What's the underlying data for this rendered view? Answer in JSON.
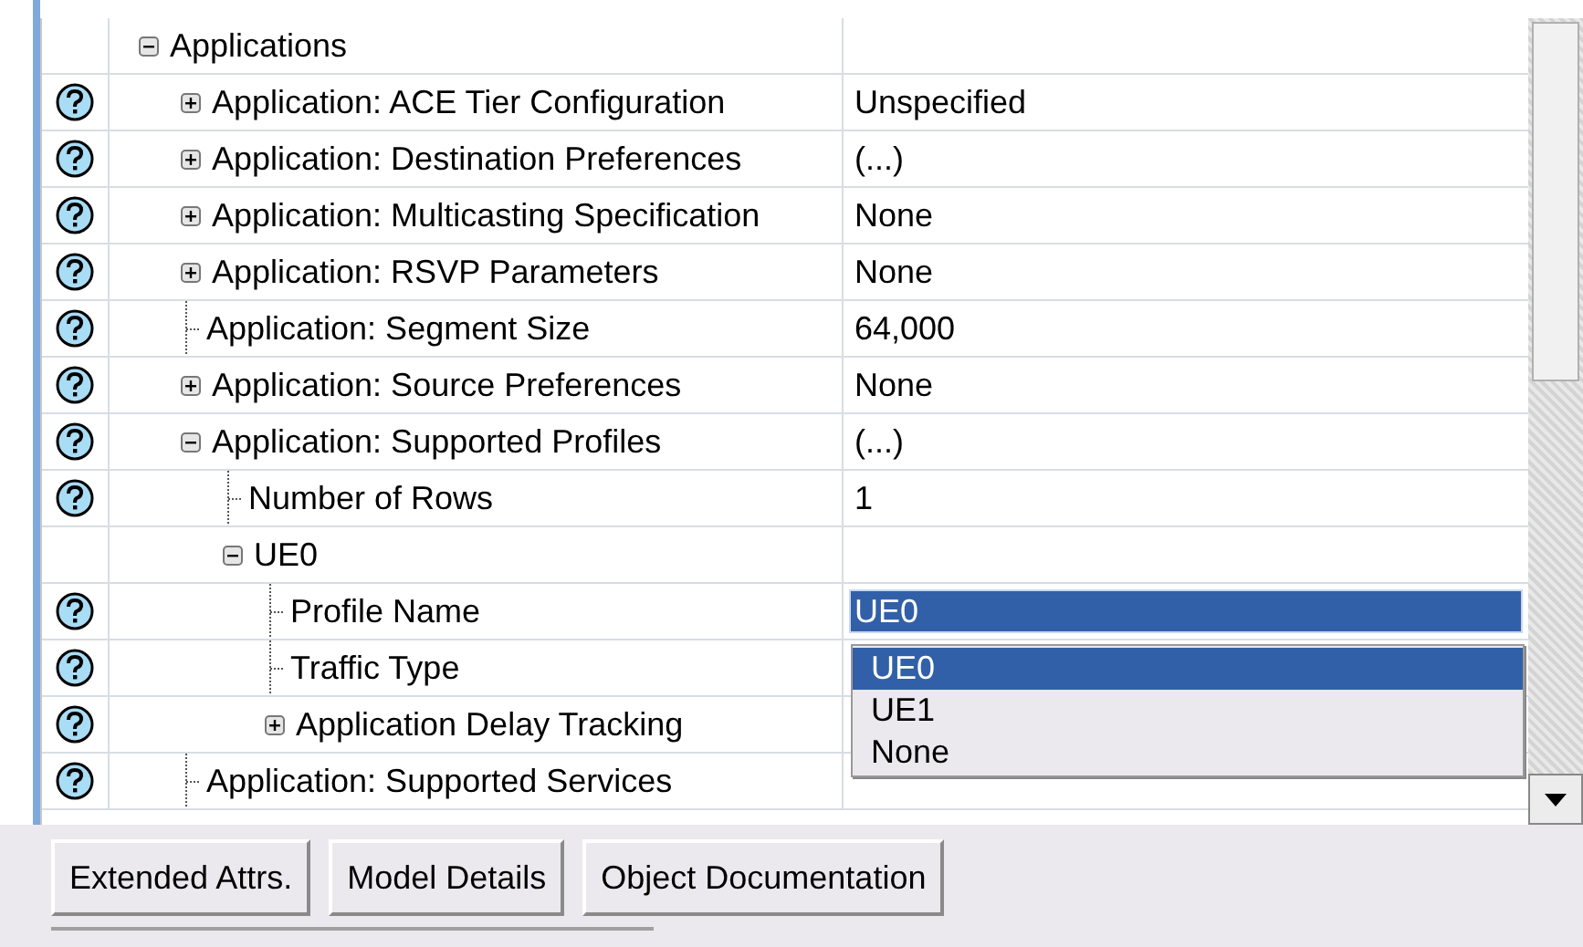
{
  "tree": [
    {
      "label": "Applications",
      "kind": "group",
      "expanded": true,
      "help": false,
      "children": [
        {
          "label": "Application: ACE Tier Configuration",
          "value": "Unspecified",
          "kind": "group",
          "expanded": false,
          "help": true
        },
        {
          "label": "Application: Destination Preferences",
          "value": "(...)",
          "kind": "group",
          "expanded": false,
          "help": true
        },
        {
          "label": "Application: Multicasting Specification",
          "value": "None",
          "kind": "group",
          "expanded": false,
          "help": true
        },
        {
          "label": "Application: RSVP Parameters",
          "value": "None",
          "kind": "group",
          "expanded": false,
          "help": true
        },
        {
          "label": "Application: Segment Size",
          "value": "64,000",
          "kind": "leaf",
          "help": true
        },
        {
          "label": "Application: Source Preferences",
          "value": "None",
          "kind": "group",
          "expanded": false,
          "help": true
        },
        {
          "label": "Application: Supported Profiles",
          "value": "(...)",
          "kind": "group",
          "expanded": true,
          "help": true,
          "children": [
            {
              "label": "Number of Rows",
              "value": "1",
              "kind": "leaf",
              "help": true
            },
            {
              "label": "UE0",
              "kind": "group",
              "expanded": true,
              "help": false,
              "children": [
                {
                  "label": "Profile Name",
                  "value": "UE0",
                  "kind": "leaf",
                  "help": true,
                  "editing": true
                },
                {
                  "label": "Traffic Type",
                  "kind": "leaf",
                  "help": true
                },
                {
                  "label": "Application Delay Tracking",
                  "kind": "group",
                  "expanded": false,
                  "help": true
                }
              ]
            }
          ]
        },
        {
          "label": "Application: Supported Services",
          "kind": "leaf",
          "help": true
        }
      ]
    }
  ],
  "dropdown": {
    "options": [
      {
        "label": "UE0",
        "selected": true
      },
      {
        "label": "UE1",
        "selected": false
      },
      {
        "label": "None",
        "selected": false
      }
    ]
  },
  "buttons": [
    {
      "label": "Extended Attrs."
    },
    {
      "label": "Model Details"
    },
    {
      "label": "Object Documentation"
    }
  ]
}
